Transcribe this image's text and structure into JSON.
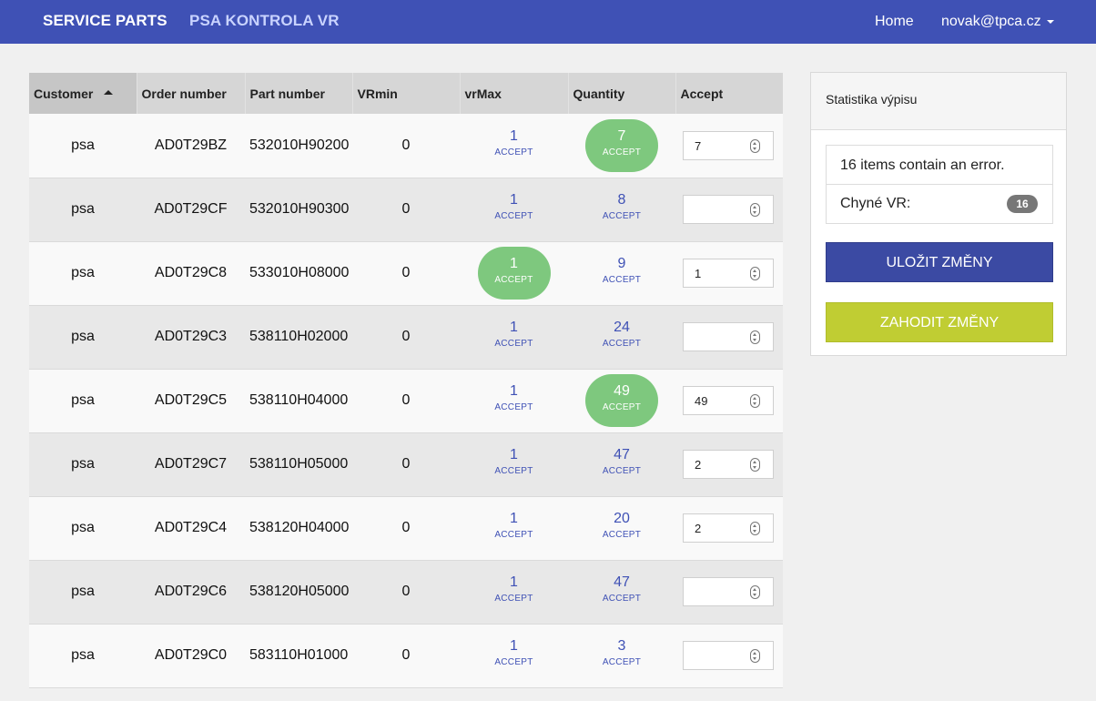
{
  "navbar": {
    "brand": "SERVICE PARTS",
    "section": "PSA KONTROLA VR",
    "home": "Home",
    "user": "novak@tpca.cz"
  },
  "table": {
    "headers": {
      "customer": "Customer",
      "order": "Order number",
      "part": "Part number",
      "vrmin": "VRmin",
      "vrmax": "vrMax",
      "quantity": "Quantity",
      "accept": "Accept"
    },
    "accept_label": "ACCEPT",
    "rows": [
      {
        "customer": "psa",
        "order": "AD0T29BZ",
        "part": "532010H90200",
        "vrmin": "0",
        "vrmax": "1",
        "vrmax_hl": false,
        "qty": "7",
        "qty_hl": true,
        "accept": "7"
      },
      {
        "customer": "psa",
        "order": "AD0T29CF",
        "part": "532010H90300",
        "vrmin": "0",
        "vrmax": "1",
        "vrmax_hl": false,
        "qty": "8",
        "qty_hl": false,
        "accept": ""
      },
      {
        "customer": "psa",
        "order": "AD0T29C8",
        "part": "533010H08000",
        "vrmin": "0",
        "vrmax": "1",
        "vrmax_hl": true,
        "qty": "9",
        "qty_hl": false,
        "accept": "1"
      },
      {
        "customer": "psa",
        "order": "AD0T29C3",
        "part": "538110H02000",
        "vrmin": "0",
        "vrmax": "1",
        "vrmax_hl": false,
        "qty": "24",
        "qty_hl": false,
        "accept": ""
      },
      {
        "customer": "psa",
        "order": "AD0T29C5",
        "part": "538110H04000",
        "vrmin": "0",
        "vrmax": "1",
        "vrmax_hl": false,
        "qty": "49",
        "qty_hl": true,
        "accept": "49"
      },
      {
        "customer": "psa",
        "order": "AD0T29C7",
        "part": "538110H05000",
        "vrmin": "0",
        "vrmax": "1",
        "vrmax_hl": false,
        "qty": "47",
        "qty_hl": false,
        "accept": "2"
      },
      {
        "customer": "psa",
        "order": "AD0T29C4",
        "part": "538120H04000",
        "vrmin": "0",
        "vrmax": "1",
        "vrmax_hl": false,
        "qty": "20",
        "qty_hl": false,
        "accept": "2"
      },
      {
        "customer": "psa",
        "order": "AD0T29C6",
        "part": "538120H05000",
        "vrmin": "0",
        "vrmax": "1",
        "vrmax_hl": false,
        "qty": "47",
        "qty_hl": false,
        "accept": ""
      },
      {
        "customer": "psa",
        "order": "AD0T29C0",
        "part": "583110H01000",
        "vrmin": "0",
        "vrmax": "1",
        "vrmax_hl": false,
        "qty": "3",
        "qty_hl": false,
        "accept": ""
      }
    ]
  },
  "panel": {
    "title": "Statistika výpisu",
    "error_text": "16 items contain an error.",
    "vr_label": "Chyné VR:",
    "vr_count": "16",
    "save_label": "ULOŽIT ZMĚNY",
    "discard_label": "ZAHODIT ZMĚNY"
  },
  "colors": {
    "navbar": "#3f51b5",
    "highlight": "#7ec87e",
    "save": "#3b4aa3",
    "discard": "#c0cd33"
  }
}
